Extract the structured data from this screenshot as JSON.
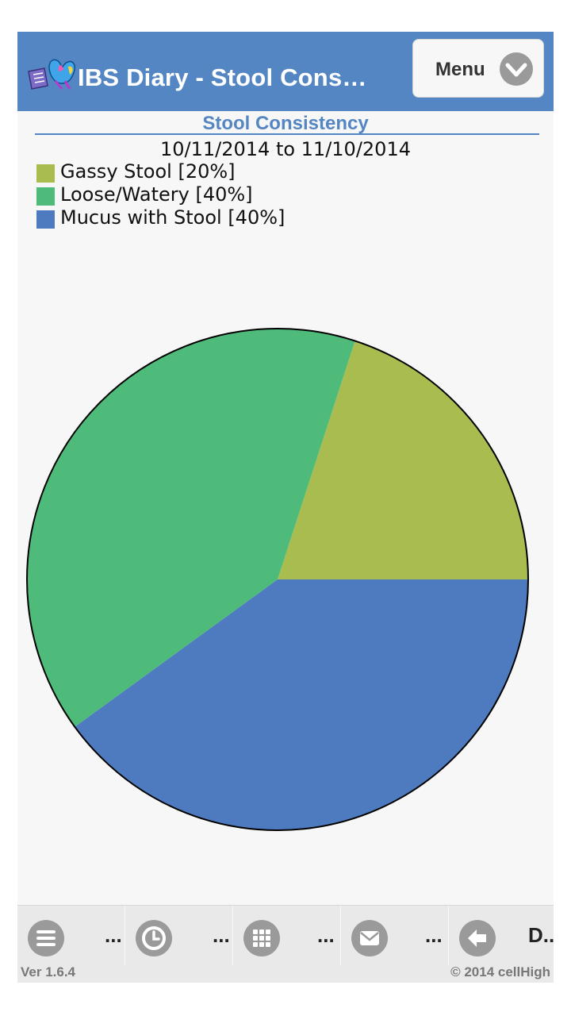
{
  "header": {
    "title": "IBS Diary - Stool Cons…",
    "menu_label": "Menu"
  },
  "chart": {
    "title": "Stool Consistency",
    "date_range": "10/11/2014 to 11/10/2014"
  },
  "legend": [
    {
      "label": "Gassy Stool [20%]",
      "color": "#a8bc4f"
    },
    {
      "label": "Loose/Watery [40%]",
      "color": "#4fbb7b"
    },
    {
      "label": "Mucus with Stool [40%]",
      "color": "#4e7bbf"
    }
  ],
  "chart_data": {
    "type": "pie",
    "title": "Stool Consistency",
    "subtitle": "10/11/2014 to 11/10/2014",
    "legend_position": "top-left",
    "slices": [
      {
        "label": "Gassy Stool",
        "value": 20,
        "color": "#a8bc4f"
      },
      {
        "label": "Loose/Watery",
        "value": 40,
        "color": "#4fbb7b"
      },
      {
        "label": "Mucus with Stool",
        "value": 40,
        "color": "#4e7bbf"
      }
    ]
  },
  "footer": {
    "tabs": [
      {
        "icon": "list-icon",
        "label": "..."
      },
      {
        "icon": "clock-icon",
        "label": "..."
      },
      {
        "icon": "grid-icon",
        "label": "..."
      },
      {
        "icon": "mail-icon",
        "label": "..."
      },
      {
        "icon": "back-arrow-icon",
        "label": "D.."
      }
    ],
    "version": "Ver 1.6.4",
    "copyright": "© 2014 cellHigh"
  }
}
